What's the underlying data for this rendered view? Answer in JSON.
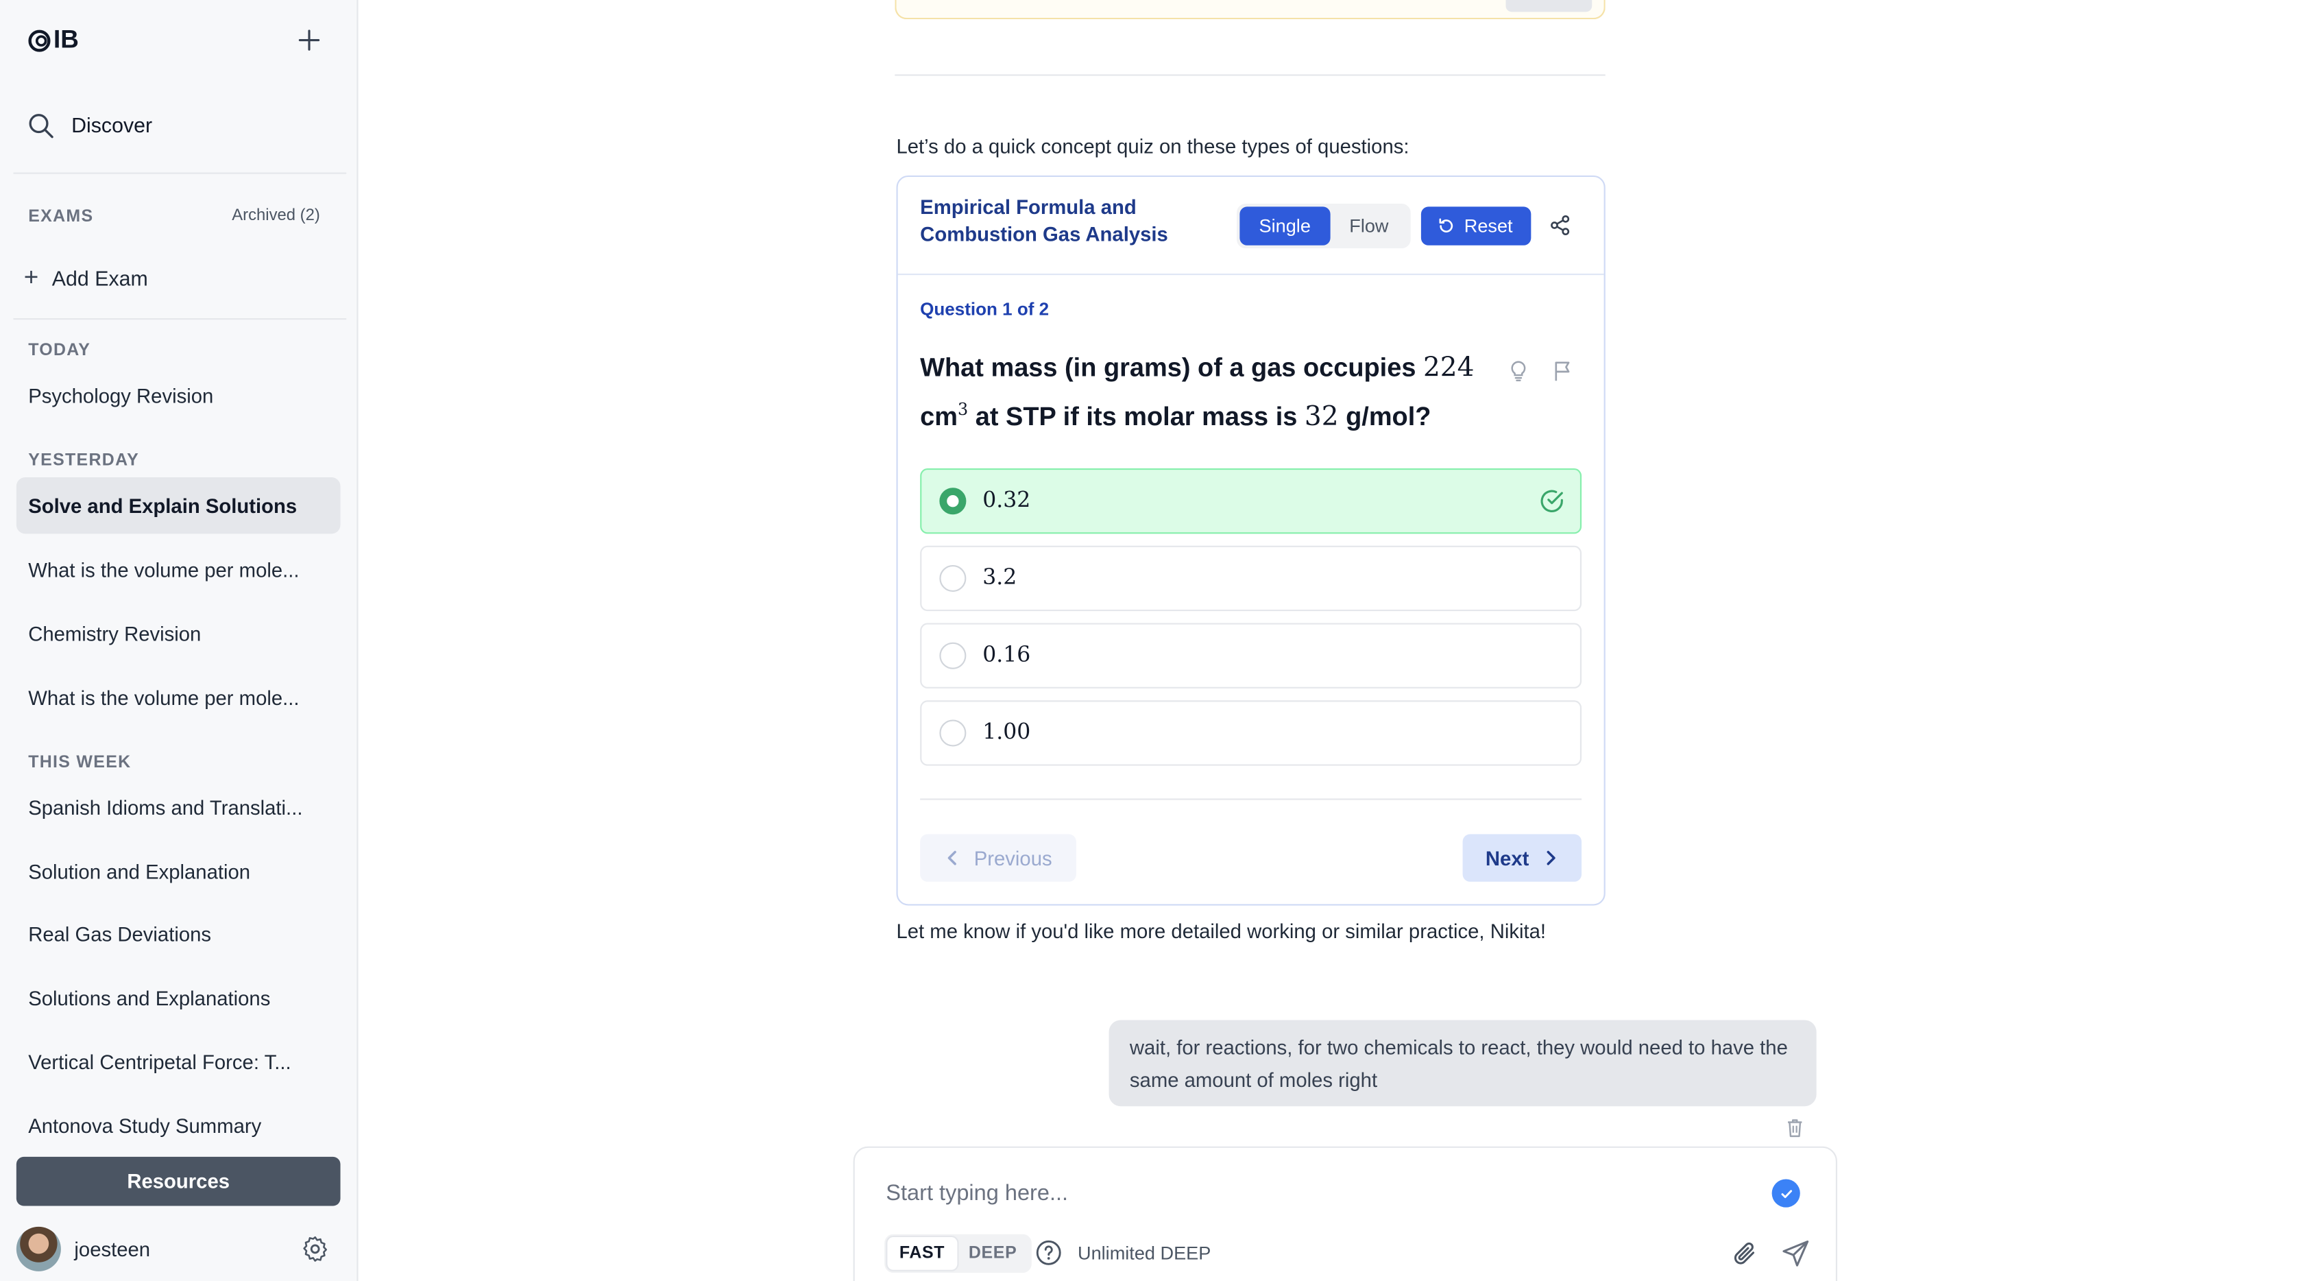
{
  "sidebar": {
    "logo_text": "IB",
    "discover_label": "Discover",
    "exams_heading": "EXAMS",
    "archived_label": "Archived (2)",
    "add_exam_label": "Add Exam",
    "today_heading": "TODAY",
    "today_items": [
      "Psychology Revision"
    ],
    "yesterday_heading": "YESTERDAY",
    "yesterday_items": [
      "Solve and Explain Solutions",
      "What is the volume per mole...",
      "Chemistry Revision",
      "What is the volume per mole..."
    ],
    "this_week_heading": "THIS WEEK",
    "this_week_items": [
      "Spanish Idioms and Translati...",
      "Solution and Explanation",
      "Real Gas Deviations",
      "Solutions and Explanations",
      "Vertical Centripetal Force: T...",
      "Antonova Study Summary"
    ],
    "resources_label": "Resources",
    "username": "joesteen"
  },
  "chat": {
    "intro_text": "Let’s do a quick concept quiz on these types of questions:",
    "outro_text": "Let me know if you'd like more detailed working or similar practice, Nikita!",
    "user_message": "wait, for reactions, for two chemicals to react, they would need to have the same amount of moles right"
  },
  "quiz": {
    "title": "Empirical Formula and Combustion Gas Analysis",
    "mode_single": "Single",
    "mode_flow": "Flow",
    "reset_label": "Reset",
    "question_counter": "Question 1 of 2",
    "question_part1": "What mass (in grams) of a gas occupies ",
    "question_num1": "224",
    "question_unit1": " cm",
    "question_sup": "3",
    "question_part2": " at STP if its molar mass is ",
    "question_num2": "32",
    "question_part3": " g/mol?",
    "options": [
      "0.32",
      "3.2",
      "0.16",
      "1.00"
    ],
    "selected_option": "0.32",
    "previous_label": "Previous",
    "next_label": "Next"
  },
  "composer": {
    "placeholder": "Start typing here...",
    "mode_fast": "FAST",
    "mode_deep": "DEEP",
    "unlimited_label": "Unlimited DEEP"
  },
  "colors": {
    "accent": "#2f5bdb",
    "correct_bg": "#dcfce7",
    "correct_radio": "#3aa66a"
  }
}
